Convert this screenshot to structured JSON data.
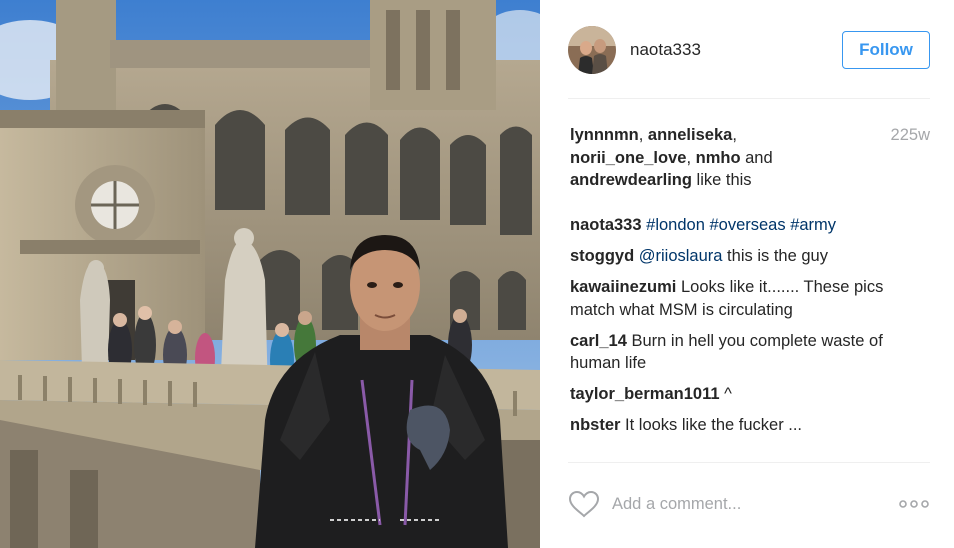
{
  "post": {
    "image": {
      "description_icon": "photo-of-man-in-front-of-cathedral"
    },
    "owner": "naota333",
    "follow_label": "Follow",
    "age": "225w",
    "likes": {
      "users": [
        "lynnnmn",
        "anneliseka",
        "norii_one_love",
        "nmho",
        "andrewdearling"
      ],
      "sep": ", ",
      "and_word": " and ",
      "suffix": " like this"
    },
    "caption": {
      "user": "naota333",
      "hashtags": [
        "#london",
        "#overseas",
        "#army"
      ]
    },
    "comments": [
      {
        "user": "stoggyd",
        "mention": "@riioslaura",
        "text": " this is the guy"
      },
      {
        "user": "kawaiinezumi",
        "text": "Looks like it....... These pics match what MSM is circulating"
      },
      {
        "user": "carl_14",
        "text": "Burn in hell you complete waste of human life"
      },
      {
        "user": "taylor_berman1011",
        "text": "^"
      },
      {
        "user": "nbster",
        "text": "It looks like the fucker ..."
      }
    ],
    "add_comment_placeholder": "Add a comment...",
    "colors": {
      "accent": "#3897f0",
      "link": "#003569",
      "muted": "#a5a7aa",
      "text": "#262626"
    },
    "icons": {
      "like": "heart-outline-icon",
      "more": "more-options-icon"
    }
  }
}
